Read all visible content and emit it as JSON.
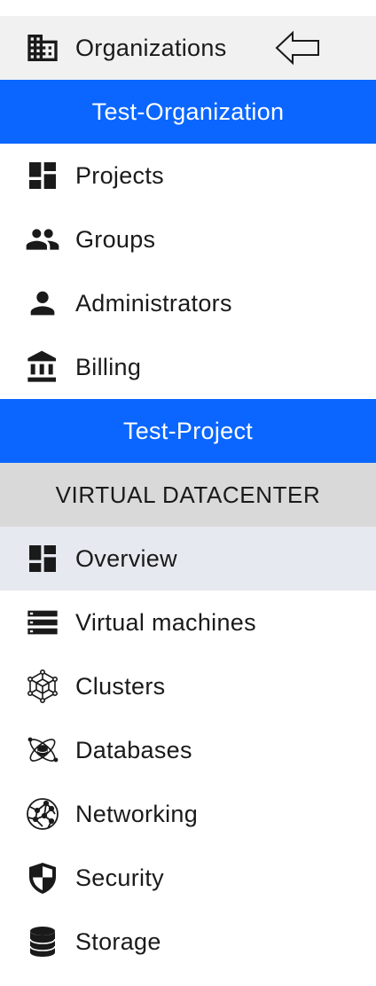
{
  "nav": {
    "organizations_label": "Organizations",
    "org_name": "Test-Organization",
    "org_items": [
      {
        "label": "Projects",
        "icon": "dashboard-icon"
      },
      {
        "label": "Groups",
        "icon": "people-icon"
      },
      {
        "label": "Administrators",
        "icon": "person-icon"
      },
      {
        "label": "Billing",
        "icon": "bank-icon"
      }
    ],
    "project_name": "Test-Project",
    "section_title": "VIRTUAL DATACENTER",
    "vdc_items": [
      {
        "label": "Overview",
        "icon": "dashboard-icon",
        "active": true
      },
      {
        "label": "Virtual machines",
        "icon": "server-stack-icon"
      },
      {
        "label": "Clusters",
        "icon": "cluster-icon"
      },
      {
        "label": "Databases",
        "icon": "database-atom-icon"
      },
      {
        "label": "Networking",
        "icon": "network-globe-icon"
      },
      {
        "label": "Security",
        "icon": "shield-icon"
      },
      {
        "label": "Storage",
        "icon": "storage-icon"
      }
    ]
  },
  "colors": {
    "accent_blue": "#0a66ff",
    "section_grey": "#d9d9d9",
    "active_row": "#e6e9ef",
    "header_row": "#f1f1f1"
  }
}
